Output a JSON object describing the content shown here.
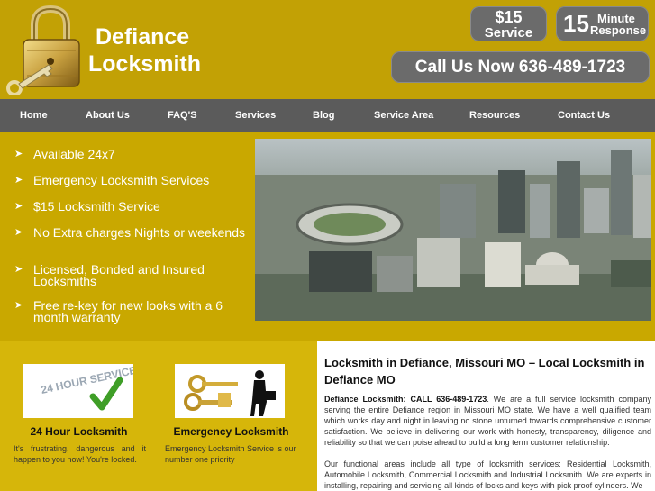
{
  "header": {
    "brand_line1": "Defiance",
    "brand_line2": "Locksmith",
    "badge_price_big": "$15",
    "badge_price_small": "Service",
    "badge_time_num": "15",
    "badge_time_line1": "Minute",
    "badge_time_line2": "Response",
    "call_text": "Call Us Now 636-489-1723"
  },
  "nav": {
    "items": [
      "Home",
      "About Us",
      "FAQ'S",
      "Services",
      "Blog",
      "Service Area",
      "Resources",
      "Contact Us"
    ]
  },
  "features": {
    "items": [
      "Available 24x7",
      "Emergency Locksmith Services",
      "$15 Locksmith Service",
      "No Extra charges Nights or weekends",
      "Licensed, Bonded and Insured Locksmiths",
      "Free re-key for new looks with a 6 month warranty"
    ]
  },
  "cards": [
    {
      "image_text": "24 HOUR SERVICE",
      "title": "24 Hour Locksmith",
      "text": "It's frustrating, dangerous and it happen to you now! You're locked."
    },
    {
      "title": "Emergency Locksmith",
      "text": "Emergency Locksmith Service is our number one priority"
    }
  ],
  "article": {
    "heading": "Locksmith in Defiance, Missouri MO – Local Locksmith in Defiance MO",
    "p1_lead": "Defiance Locksmith: CALL 636-489-1723",
    "p1_body": ". We are a full service locksmith company serving the entire Defiance region in Missouri MO state. We have a well qualified team which works day and night in leaving no stone unturned towards comprehensive customer satisfaction. We believe in delivering our work with honesty, transparency, diligence and reliability so that we can poise ahead to build a long term customer relationship.",
    "p2": "Our functional areas include all type of locksmith services: Residential Locksmith, Automobile Locksmith, Commercial Locksmith and Industrial Locksmith. We are experts in installing, repairing and servicing all kinds of locks and keys with pick proof cylinders. We"
  },
  "colors": {
    "header_bg": "#c2a105",
    "nav_bg": "#5b5b5b",
    "panel_bg": "#d6b60a",
    "pill_bg": "#6b6b6b"
  }
}
